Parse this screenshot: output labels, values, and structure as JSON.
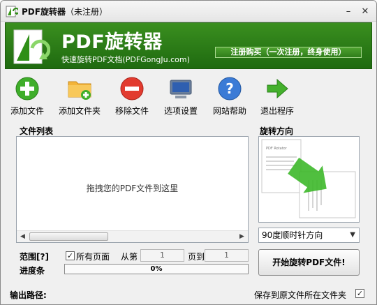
{
  "window": {
    "title": "PDF旋转器",
    "title_suffix": "（未注册）",
    "minimize_glyph": "–",
    "close_glyph": "✕"
  },
  "banner": {
    "title": "PDF旋转器",
    "subtitle": "快速旋转PDF文档(PDFGongJu.com)",
    "register_label": "注册购买（一次注册，终身使用）",
    "bg_color": "#2c7d17"
  },
  "toolbar": {
    "items": [
      {
        "label": "添加文件",
        "icon": "add-icon"
      },
      {
        "label": "添加文件夹",
        "icon": "folder-add-icon"
      },
      {
        "label": "移除文件",
        "icon": "remove-icon"
      },
      {
        "label": "选项设置",
        "icon": "settings-monitor-icon"
      },
      {
        "label": "网站帮助",
        "icon": "help-icon"
      },
      {
        "label": "退出程序",
        "icon": "exit-arrow-icon"
      }
    ]
  },
  "file_list": {
    "heading": "文件列表",
    "drop_hint": "拖拽您的PDF文件到这里"
  },
  "rotation": {
    "heading": "旋转方向",
    "selected": "90度顺时针方向",
    "preview_page_text": "PDF Rotator"
  },
  "range": {
    "label": "范围[?]",
    "all_pages_label": "所有页面",
    "all_pages_checked": true,
    "from_label": "从第",
    "from_value": "1",
    "to_label": "页到",
    "to_value": "1"
  },
  "progress": {
    "label": "进度条",
    "percent": 0,
    "text": "0%"
  },
  "start_button": "开始旋转PDF文件!",
  "output": {
    "label": "输出路径:",
    "save_same_folder_label": "保存到原文件所在文件夹",
    "save_same_folder_checked": true
  }
}
